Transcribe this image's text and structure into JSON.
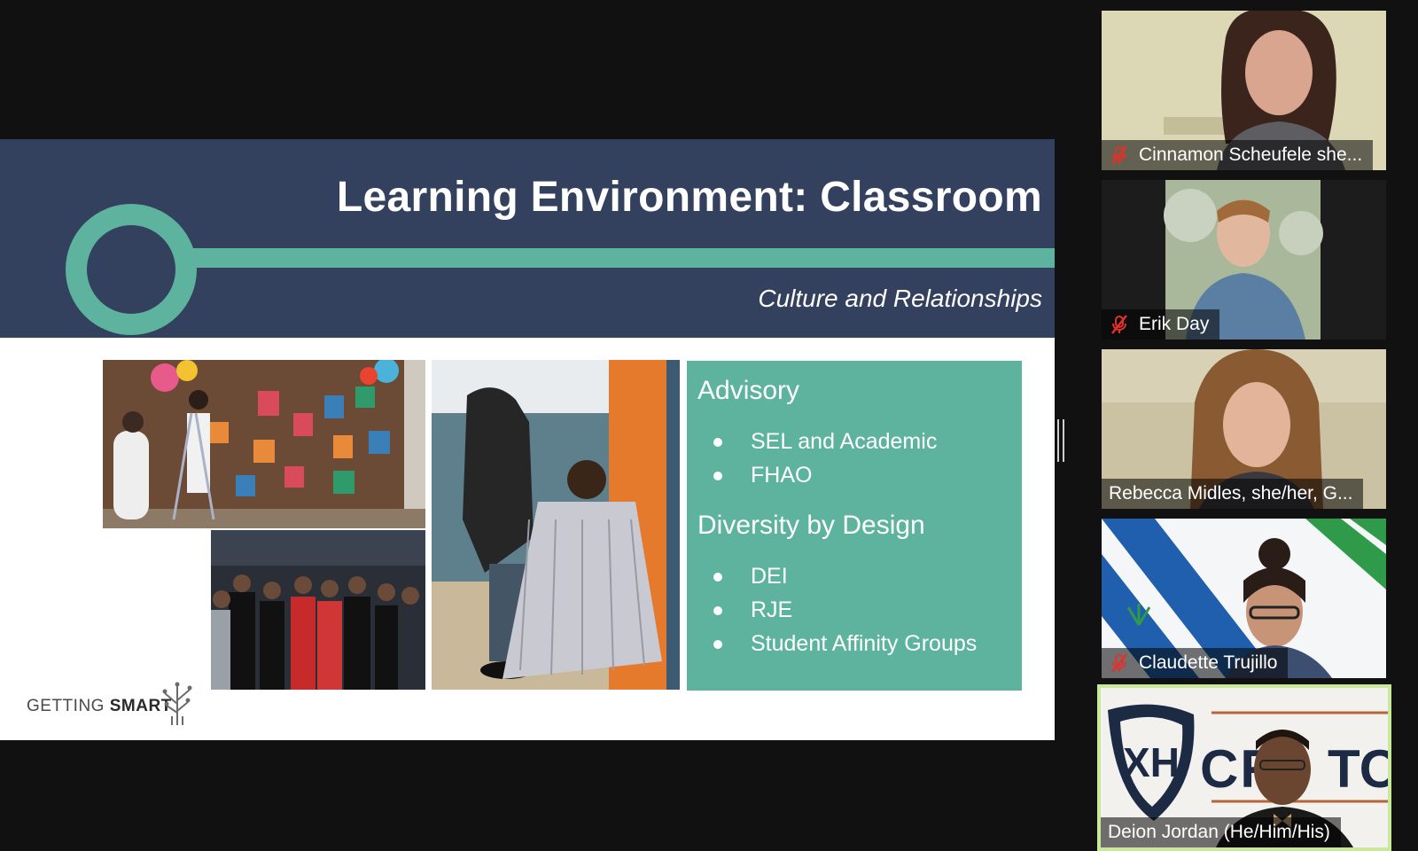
{
  "slide": {
    "title": "Learning Environment: Classroom",
    "subtitle": "Culture and Relationships",
    "box": {
      "heading1": "Advisory",
      "list1": [
        "SEL and Academic",
        "FHAO"
      ],
      "heading2": "Diversity by Design",
      "list2": [
        "DEI",
        "RJE",
        "Student Affinity Groups"
      ]
    },
    "logo": {
      "part1": "GETTING ",
      "part2": "SMART"
    }
  },
  "participants": [
    {
      "name": "Cinnamon Scheufele she...",
      "muted": true
    },
    {
      "name": "Erik Day",
      "muted": true
    },
    {
      "name": "Rebecca Midles, she/her, G...",
      "muted": false
    },
    {
      "name": "Claudette Trujillo",
      "muted": true
    },
    {
      "name": "Deion Jordan (He/Him/His)",
      "muted": false,
      "active_speaker": true
    }
  ],
  "colors": {
    "slide_header": "#33415f",
    "accent_teal": "#5db39d",
    "active_speaker_border": "#c8e89a",
    "mute_red": "#e0322b"
  }
}
